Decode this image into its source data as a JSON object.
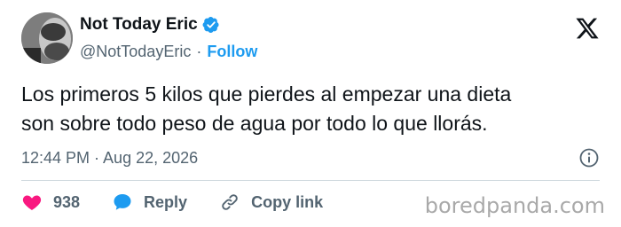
{
  "author": {
    "display_name": "Not Today Eric",
    "handle": "@NotTodayEric",
    "separator": "·",
    "follow_label": "Follow",
    "verified_color": "#1d9bf0"
  },
  "tweet": {
    "text_line1": "Los primeros 5 kilos que pierdes al empezar una dieta",
    "text_line2": "son sobre todo peso de agua por todo lo que llorás.",
    "timestamp": "12:44 PM · Aug 22, 2026"
  },
  "actions": {
    "like_count": "938",
    "reply_label": "Reply",
    "copy_link_label": "Copy link"
  },
  "icons": {
    "logo": "x-logo-icon",
    "verified": "verified-badge-icon",
    "info": "info-icon",
    "like": "heart-icon",
    "reply": "reply-bubble-icon",
    "copy": "link-icon"
  },
  "colors": {
    "accent": "#1d9bf0",
    "like": "#f91880",
    "text": "#0f1419",
    "muted": "#536471"
  },
  "watermark": "boredpanda.com"
}
